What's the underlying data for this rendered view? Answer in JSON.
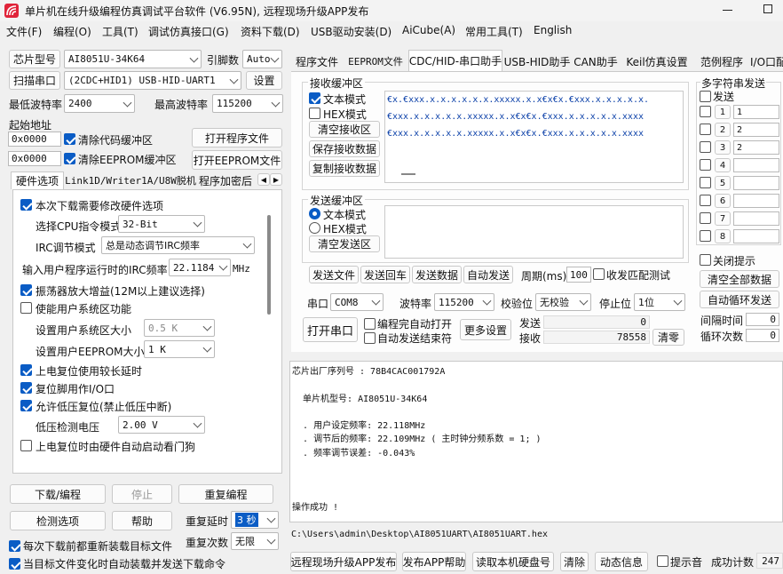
{
  "window": {
    "title": "单片机在线升级编程仿真调试平台软件 (V6.95N), 远程现场升级APP发布",
    "logo_color": "#e0243a"
  },
  "menu": [
    "文件(F)",
    "编程(O)",
    "工具(T)",
    "调试仿真接口(G)",
    "资料下载(D)",
    "USB驱动安装(D)",
    "AiCube(A)",
    "常用工具(T)",
    "English"
  ],
  "left": {
    "chip_label": "芯片型号",
    "chip_value": "AI8051U-34K64",
    "pin_label": "引脚数",
    "pin_value": "Auto",
    "scan_button": "扫描串口",
    "port_value": "(2CDC+HID1) USB-HID-UART1",
    "settings_button": "设置",
    "min_baud_label": "最低波特率",
    "min_baud_value": "2400",
    "max_baud_label": "最高波特率",
    "max_baud_value": "115200",
    "start_addr_label": "起始地址",
    "addr1": "0x0000",
    "clear_code_label": "清除代码缓冲区",
    "open_program_button": "打开程序文件",
    "addr2": "0x0000",
    "clear_eeprom_label": "清除EEPROM缓冲区",
    "open_eeprom_button": "打开EEPROM文件",
    "tabs": [
      "硬件选项",
      "Link1D/Writer1A/U8W脱机",
      "程序加密后"
    ],
    "options": {
      "modify_hw": "本次下载需要修改硬件选项",
      "cpu_mode_label": "选择CPU指令模式",
      "cpu_mode_value": "32-Bit",
      "irc_label": "IRC调节模式",
      "irc_value": "总是动态调节IRC频率",
      "freq_label": "输入用户程序运行时的IRC频率",
      "freq_value": "22.1184",
      "freq_unit": "MHz",
      "osc_gain": "振荡器放大增益(12M以上建议选择)",
      "user_sys_area": "使能用户系统区功能",
      "sys_size_label": "设置用户系统区大小",
      "sys_size_value": "0.5 K",
      "eeprom_size_label": "设置用户EEPROM大小",
      "eeprom_size_value": "1   K",
      "power_delay": "上电复位使用较长延时",
      "reset_io": "复位脚用作I/O口",
      "lvr": "允许低压复位(禁止低压中断)",
      "lvd_label": "低压检测电压",
      "lvd_value": "2.00 V",
      "watchdog": "上电复位时由硬件自动启动看门狗"
    },
    "download_button": "下载/编程",
    "stop_button": "停止",
    "repeat_button": "重复编程",
    "detect_button": "检测选项",
    "help_button": "帮助",
    "repeat_delay_label": "重复延时",
    "repeat_delay_value": "3 秒",
    "repeat_count_label": "重复次数",
    "repeat_count_value": "无限",
    "reload_label": "每次下载前都重新装载目标文件",
    "auto_send_label": "当目标文件变化时自动装载并发送下载命令"
  },
  "right_tabs": [
    "程序文件",
    "EEPROM文件",
    "CDC/HID-串口助手",
    "USB-HID助手",
    "CAN助手",
    "Keil仿真设置",
    "范例程序",
    "I/O口配"
  ],
  "serial": {
    "recv_title": "接收缓冲区",
    "text_mode": "文本模式",
    "hex_mode": "HEX模式",
    "clear_recv": "清空接收区",
    "save_recv": "保存接收数据",
    "copy_recv": "复制接收数据",
    "recv_lines": [
      "€x.€xxx.x.x.x.x.x.x.xxxxx.x.x€x€x.€xxx.x.x.x.x.x.",
      "€xxx.x.x.x.x.x.xxxxx.x.x€x€x.€xxx.x.x.x.x.x.xxxx",
      "€xxx.x.x.x.x.x.xxxxx.x.x€x€x.€xxx.x.x.x.x.x.xxxx"
    ],
    "send_title": "发送缓冲区",
    "send_text_mode": "文本模式",
    "send_hex_mode": "HEX模式",
    "clear_send": "清空发送区",
    "send_file": "发送文件",
    "send_return": "发送回车",
    "send_data": "发送数据",
    "auto_send": "自动发送",
    "period_label": "周期(ms)",
    "period_value": "100",
    "match_test": "收发匹配测试",
    "port_label": "串口",
    "port_value": "COM8",
    "baud_label": "波特率",
    "baud_value": "115200",
    "parity_label": "校验位",
    "parity_value": "无校验",
    "stop_label": "停止位",
    "stop_value": "1位",
    "open_port": "打开串口",
    "auto_open": "编程完自动打开",
    "auto_send_end": "自动发送结束符",
    "more_settings": "更多设置",
    "send_count_label": "发送",
    "send_count": "0",
    "recv_count_label": "接收",
    "recv_count": "78558",
    "clear_count": "清零"
  },
  "multi": {
    "title": "多字符串发送",
    "send_label": "发送",
    "items": [
      {
        "num": "1",
        "value": "1"
      },
      {
        "num": "2",
        "value": "2"
      },
      {
        "num": "3",
        "value": "2"
      },
      {
        "num": "4",
        "value": ""
      },
      {
        "num": "5",
        "value": ""
      },
      {
        "num": "6",
        "value": ""
      },
      {
        "num": "7",
        "value": ""
      },
      {
        "num": "8",
        "value": ""
      }
    ],
    "close_hint": "关闭提示",
    "clear_all": "清空全部数据",
    "auto_loop": "自动循环发送",
    "interval_label": "间隔时间",
    "interval_value": "0",
    "loop_label": "循环次数",
    "loop_value": "0"
  },
  "log": {
    "lines": [
      "芯片出厂序列号 : 78B4CAC001792A",
      "",
      "  单片机型号: AI8051U-34K64",
      "",
      "  . 用户设定频率: 22.118MHz",
      "  . 调节后的频率: 22.109MHz ( 主时钟分频系数 = 1; )",
      "  . 频率调节误差: -0.043%",
      "",
      "",
      "",
      "操作成功 !"
    ],
    "path": "C:\\Users\\admin\\Desktop\\AI8051UART\\AI8051UART.hex"
  },
  "bottom": {
    "publish": "远程现场升级APP发布",
    "publish_help": "发布APP帮助",
    "read_disk": "读取本机硬盘号",
    "clear": "清除",
    "dynamic": "动态信息",
    "beep": "提示音",
    "success_label": "成功计数",
    "success_count": "247"
  }
}
